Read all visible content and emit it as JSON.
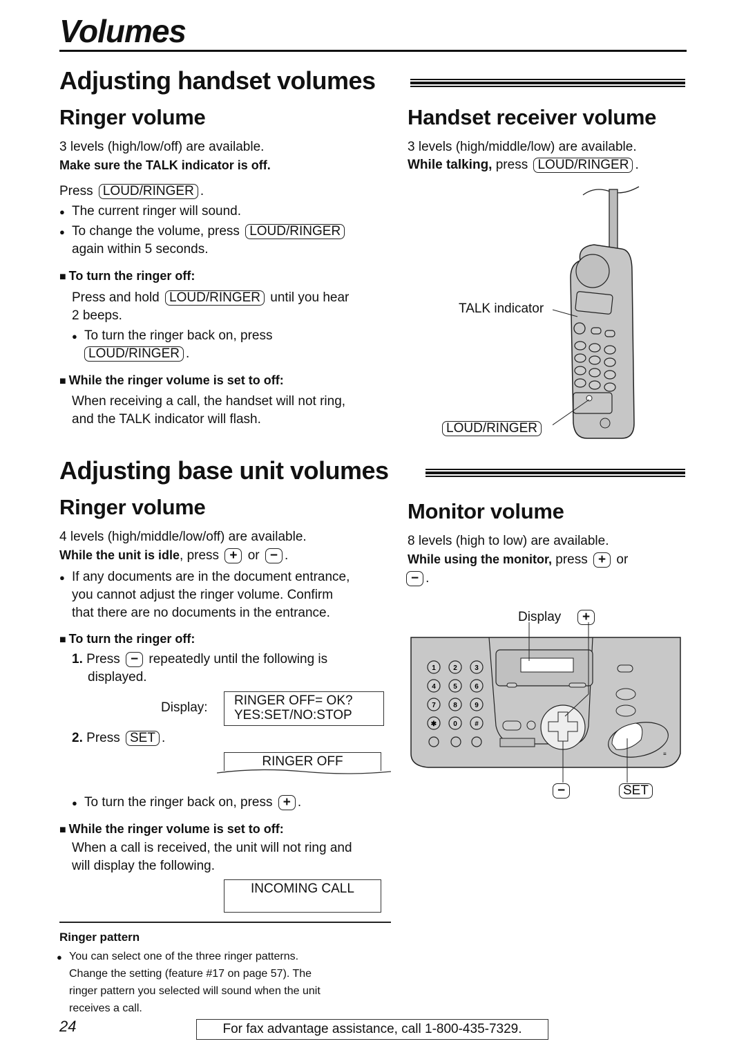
{
  "page_title": "Volumes",
  "handset_section": {
    "title": "Adjusting handset volumes",
    "ringer": {
      "heading": "Ringer volume",
      "levels": "3 levels (high/low/off) are available.",
      "note": "Make sure the TALK indicator is off.",
      "press_prefix": "Press",
      "press_key": "LOUD/RINGER",
      "bullet1": "The current ringer will sound.",
      "bullet2_prefix": "To change the volume, press",
      "bullet2_key": "LOUD/RINGER",
      "bullet2_suffix": "again within 5 seconds.",
      "turn_off": {
        "heading": "To turn the ringer off:",
        "line1_prefix": "Press and hold",
        "line1_key": "LOUD/RINGER",
        "line1_suffix": "until you hear",
        "line2": "2 beeps.",
        "bullet_prefix": "To turn the ringer back on, press",
        "bullet_key": "LOUD/RINGER"
      },
      "while_off": {
        "heading": "While the ringer volume is set to off:",
        "line1": "When receiving a call, the handset will not ring,",
        "line2": "and the TALK indicator will flash."
      }
    },
    "receiver": {
      "heading": "Handset receiver volume",
      "levels": "3 levels (high/middle/low) are available.",
      "instr_bold": "While talking,",
      "instr_text": "press",
      "instr_key": "LOUD/RINGER",
      "illustration": {
        "talk_label": "TALK indicator",
        "key_label": "LOUD/RINGER"
      }
    }
  },
  "base_section": {
    "title": "Adjusting base unit volumes",
    "ringer": {
      "heading": "Ringer volume",
      "levels": "4 levels (high/middle/low/off) are available.",
      "instr_bold": "While the unit is idle",
      "instr_text": ", press",
      "instr_or": "or",
      "key_plus": "+",
      "key_minus": "−",
      "bullet_lines": [
        "If any documents are in the document entrance,",
        "you cannot adjust the ringer volume. Confirm",
        "that there are no documents in the entrance."
      ],
      "turn_off": {
        "heading": "To turn the ringer off:",
        "step1_num": "1.",
        "step1_prefix": "Press",
        "step1_key": "−",
        "step1_suffix": "repeatedly until the following is",
        "step1_line2": "displayed.",
        "display_label": "Display:",
        "display_line1": "RINGER OFF= OK?",
        "display_line2": "YES:SET/NO:STOP",
        "step2_num": "2.",
        "step2_prefix": "Press",
        "step2_key": "SET",
        "display2": "RINGER OFF",
        "bullet_prefix": "To turn the ringer back on, press",
        "bullet_key": "+"
      },
      "while_off": {
        "heading": "While the ringer volume is set to off:",
        "line1": "When a call is received, the unit will not ring and",
        "line2": "will display the following.",
        "display": "INCOMING CALL"
      },
      "ringer_pattern": {
        "heading": "Ringer pattern",
        "lines": [
          "You can select one of the three ringer patterns.",
          "Change the setting (feature #17 on page 57). The",
          "ringer pattern you selected will sound when the unit",
          "receives a call."
        ]
      }
    },
    "monitor": {
      "heading": "Monitor volume",
      "levels": "8 levels (high to low) are available.",
      "instr_bold": "While using the monitor,",
      "instr_text": "press",
      "instr_or": "or",
      "key_plus": "+",
      "key_minus": "−",
      "illustration": {
        "display_label": "Display",
        "plus_label": "+",
        "minus_label": "−",
        "set_label": "SET",
        "keypad": [
          "1",
          "2",
          "3",
          "4",
          "5",
          "6",
          "7",
          "8",
          "9",
          "✱",
          "0",
          "#"
        ]
      }
    }
  },
  "footer": {
    "page_number": "24",
    "assistance": "For fax advantage assistance, call 1-800-435-7329."
  }
}
